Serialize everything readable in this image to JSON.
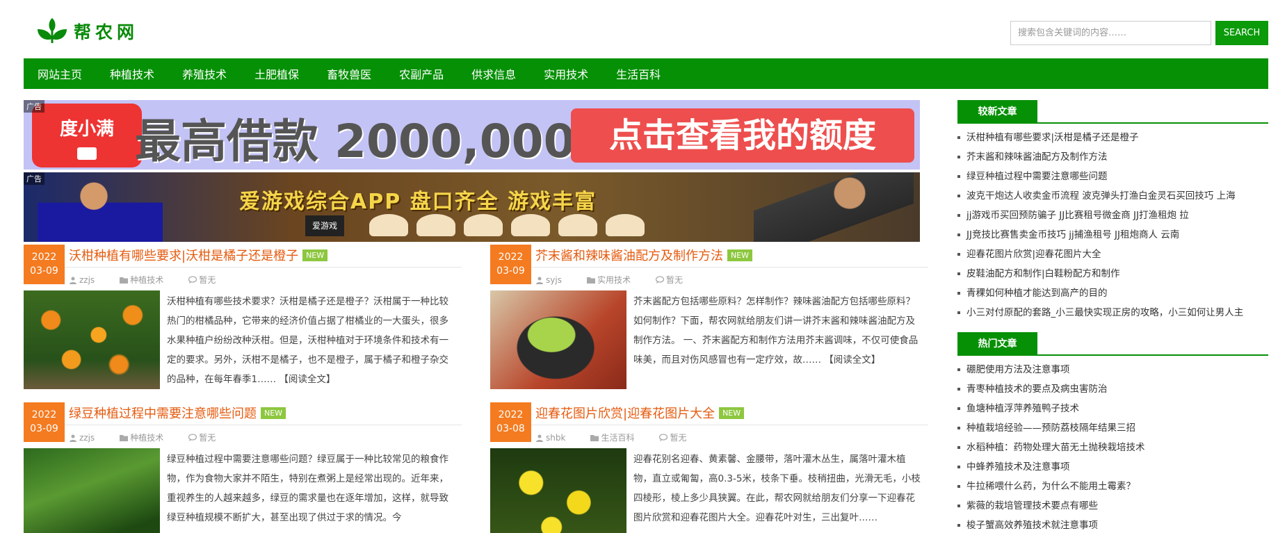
{
  "site": {
    "name": "帮农网"
  },
  "search": {
    "placeholder": "搜索包含关键词的内容……",
    "button_label": "SEARCH"
  },
  "nav": {
    "items": [
      "网站主页",
      "种植技术",
      "养殖技术",
      "土肥植保",
      "畜牧兽医",
      "农副产品",
      "供求信息",
      "实用技术",
      "生活百科"
    ]
  },
  "ads": {
    "tag": "广告",
    "banner1": {
      "brand": "度小满",
      "headline": "最高借款 2000,000",
      "cta": "点击查看我的额度"
    },
    "banner2": {
      "headline": "爱游戏综合APP 盘口齐全 游戏丰富",
      "logo": "爱游戏"
    }
  },
  "articles": [
    {
      "year": "2022",
      "day": "03-09",
      "title": "沃柑种植有哪些要求|沃柑是橘子还是橙子",
      "badge": "NEW",
      "author": "zzjs",
      "category": "种植技术",
      "comments": "暂无",
      "excerpt": "沃柑种植有哪些技术要求？沃柑是橘子还是橙子？沃柑属于一种比较热门的柑橘品种，它带来的经济价值占据了柑橘业的一大蛋头，很多水果种植户纷纷改种沃柑。但是，沃柑种植对于环境条件和技术有一定的要求。另外，沃柑不是橘子，也不是橙子，属于橘子和橙子杂交的品种，在每年春季1……",
      "read_more": "【阅读全文】"
    },
    {
      "year": "2022",
      "day": "03-09",
      "title": "芥末酱和辣味酱油配方及制作方法",
      "badge": "NEW",
      "author": "syjs",
      "category": "实用技术",
      "comments": "暂无",
      "excerpt": "芥末酱配方包括哪些原料？怎样制作？辣味酱油配方包括哪些原料？如何制作？下面，帮农网就给朋友们讲一讲芥末酱和辣味酱油配方及制作方法。 一、芥末酱配方和制作方法用芥末酱调味，不仅可使食品味美，而且对伤风感冒也有一定疗效，故……",
      "read_more": "【阅读全文】"
    },
    {
      "year": "2022",
      "day": "03-09",
      "title": "绿豆种植过程中需要注意哪些问题",
      "badge": "NEW",
      "author": "zzjs",
      "category": "种植技术",
      "comments": "暂无",
      "excerpt": "绿豆种植过程中需要注意哪些问题？绿豆属于一种比较常见的粮食作物，作为食物大家并不陌生，特别在煮粥上是经常出现的。近年来，重视养生的人越来越多，绿豆的需求量也在逐年增加，这样，就导致绿豆种植规模不断扩大，甚至出现了供过于求的情况。今",
      "read_more": ""
    },
    {
      "year": "2022",
      "day": "03-08",
      "title": "迎春花图片欣赏|迎春花图片大全",
      "badge": "NEW",
      "author": "shbk",
      "category": "生活百科",
      "comments": "暂无",
      "excerpt": "迎春花别名迎春、黄素馨、金腰带，落叶灌木丛生，属落叶灌木植物，直立或匍匐，高0.3-5米，枝条下垂。枝稍扭曲，光滑无毛，小枝四棱形，棱上多少具狭翼。在此，帮农网就给朋友们分享一下迎春花图片欣赏和迎春花图片大全。迎春花叶对生，三出复叶……",
      "read_more": ""
    }
  ],
  "sidebar": {
    "latest": {
      "heading": "较新文章",
      "items": [
        "沃柑种植有哪些要求|沃柑是橘子还是橙子",
        "芥末酱和辣味酱油配方及制作方法",
        "绿豆种植过程中需要注意哪些问题",
        "波克干炮达人收卖金币流程 波克弹头打渔白金灵石买回技巧 上海",
        "jj游戏币买回预防骗子 JJ比赛租号微金商 JJ打渔租炮 拉",
        "JJ竞技比赛售卖金币技巧 jj捕渔租号 JJ租炮商人 云南",
        "迎春花图片欣赏|迎春花图片大全",
        "皮鞋油配方和制作|白鞋粉配方和制作",
        "青稞如何种植才能达到高产的目的",
        "小三对付原配的套路_小三最快实现正房的攻略，小三如何让男人主"
      ]
    },
    "hot": {
      "heading": "热门文章",
      "items": [
        "硼肥使用方法及注意事项",
        "青枣种植技术的要点及病虫害防治",
        "鱼塘种植浮萍养殖鸭子技术",
        "种植栽培经验——预防荔枝隔年结果三招",
        "水稻种植：药物处理大苗无土抛秧栽培技术",
        "中蜂养殖技术及注意事项",
        "牛拉稀喂什么药，为什么不能用土霉素？",
        "紫薇的栽培管理技术要点有哪些",
        "梭子蟹高效养殖技术就注意事项"
      ]
    }
  }
}
